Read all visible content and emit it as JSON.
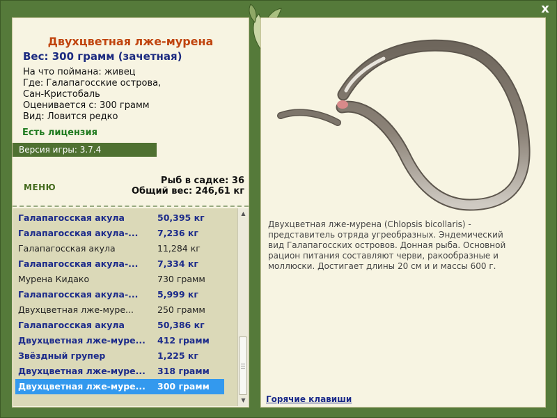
{
  "fish": {
    "title": "Двухцветная лже-мурена",
    "weight_line": "Вес: 300 грамм (зачетная)",
    "info": [
      "На что поймана: живец",
      "Где: Галапагосские острова,",
      "Сан-Кристобаль",
      "Оценивается с: 300 грамм",
      "Вид: Ловится редко"
    ],
    "license": "Есть лицензия",
    "version": "Версия игры: 3.7.4",
    "description": "Двухцветная лже-мурена (Chlopsis bicollaris) - представитель отряда угреобразных. Эндемический вид Галапагосских островов. Донная рыба. Основной рацион питания составляют черви, ракообразные и моллюски. Достигает длины 20 см и и массы 600 г."
  },
  "menu_label": "МЕНЮ",
  "stats": {
    "fish_in_net": "Рыб в садке: 36",
    "total_weight": "Общий вес: 246,61 кг"
  },
  "catch_list": [
    {
      "name": "Галапагосская акула",
      "weight": "50,395 кг",
      "style": "bold"
    },
    {
      "name": "Галапагосская акула-...",
      "weight": "7,236 кг",
      "style": "bold"
    },
    {
      "name": "Галапагосская акула",
      "weight": "11,284 кг",
      "style": "normal"
    },
    {
      "name": "Галапагосская акула-...",
      "weight": "7,334 кг",
      "style": "bold"
    },
    {
      "name": "Мурена Кидако",
      "weight": "730 грамм",
      "style": "normal"
    },
    {
      "name": "Галапагосская акула-...",
      "weight": "5,999 кг",
      "style": "bold"
    },
    {
      "name": "Двухцветная лже-муре...",
      "weight": "250 грамм",
      "style": "normal"
    },
    {
      "name": "Галапагосская акула",
      "weight": "50,386 кг",
      "style": "bold"
    },
    {
      "name": "Двухцветная лже-муре...",
      "weight": "412 грамм",
      "style": "bold"
    },
    {
      "name": "Звёздный групер",
      "weight": "1,225 кг",
      "style": "bold"
    },
    {
      "name": "Двухцветная лже-муре...",
      "weight": "318 грамм",
      "style": "bold"
    },
    {
      "name": "Двухцветная лже-муре...",
      "weight": "300 грамм",
      "style": "sel"
    }
  ],
  "hotkeys_link": "Горячие клавиши",
  "close_label": "x",
  "icons": {
    "close": "close-icon",
    "ornament": "leaf-ornament-icon",
    "scroll_up": "arrow-up-icon",
    "scroll_down": "arrow-down-icon"
  },
  "colors": {
    "frame": "#557a3a",
    "panel": "#f7f4e2",
    "title": "#c0440e",
    "accent_text": "#1c2b80",
    "selection": "#3399ee"
  }
}
